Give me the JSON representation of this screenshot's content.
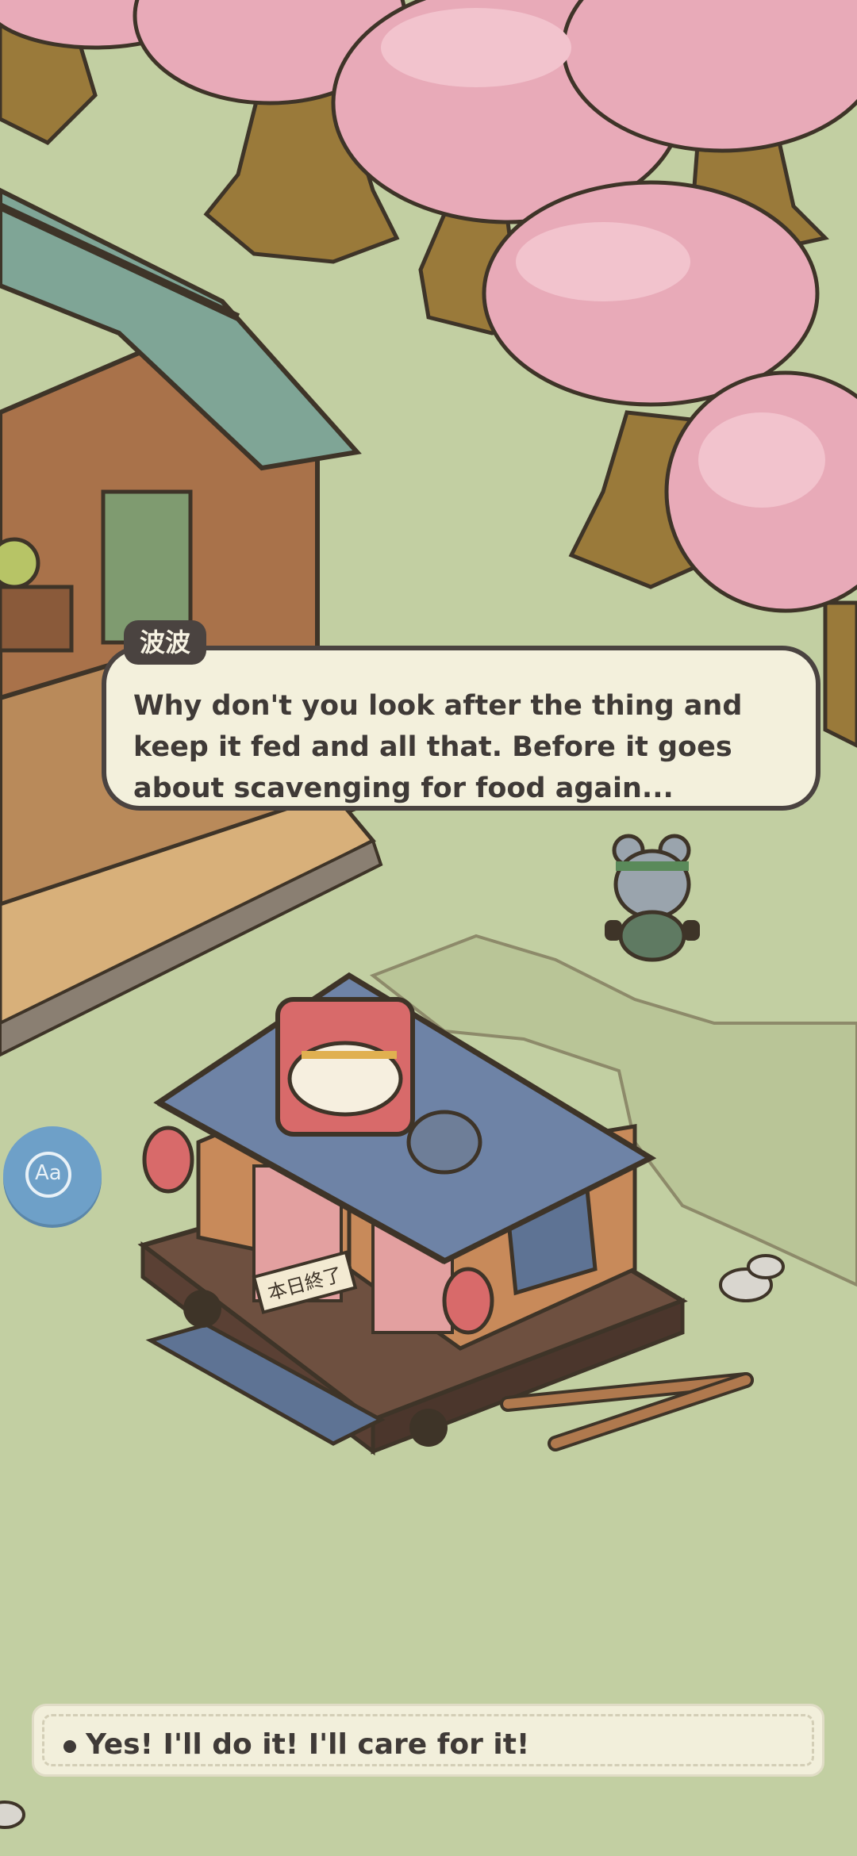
{
  "dialogue": {
    "speaker": "波波",
    "text": "Why don't you look after the thing and keep it fed and all that. Before it goes about scavenging for food again..."
  },
  "choices": [
    {
      "label": "Yes! I'll do it! I'll care for it!"
    }
  ],
  "text_size_button": {
    "label": "Aa"
  },
  "stall_sign": "本日終了",
  "colors": {
    "grass": "#c2cfa2",
    "bubble_bg": "#f3f0dc",
    "bubble_border": "#4a4340",
    "text": "#3f3a37",
    "blossom": "#e8aab8",
    "button_blue": "#6ea0c8"
  }
}
